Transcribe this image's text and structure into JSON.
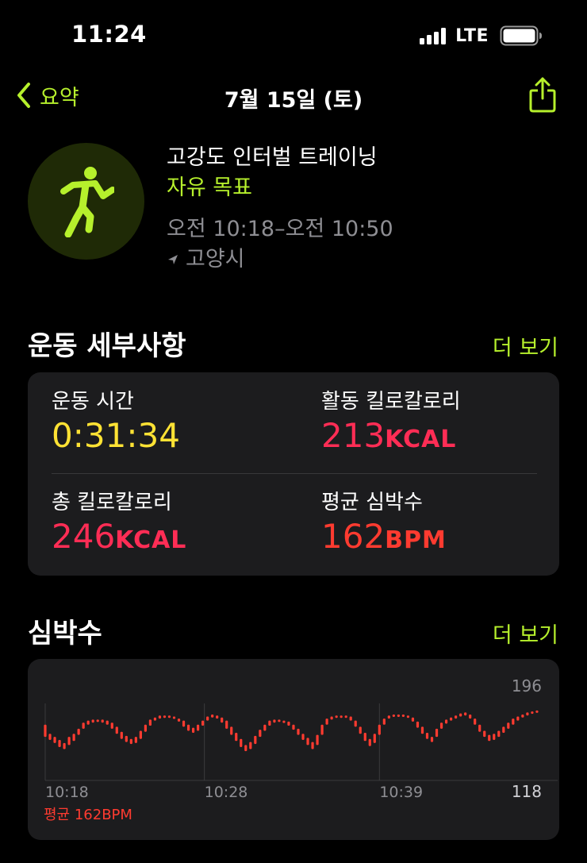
{
  "status_bar": {
    "time": "11:24",
    "network": "LTE"
  },
  "nav": {
    "back_label": "요약",
    "title": "7월 15일 (토)"
  },
  "workout": {
    "name": "고강도 인터벌 트레이닝",
    "goal": "자유 목표",
    "time_range": "오전 10:18–오전 10:50",
    "location": "고양시"
  },
  "details": {
    "title": "운동 세부사항",
    "more_label": "더 보기",
    "metrics": [
      {
        "label": "운동 시간",
        "value": "0:31:34",
        "unit": "",
        "color": "#ffe234"
      },
      {
        "label": "활동 킬로칼로리",
        "value": "213",
        "unit": "KCAL",
        "color": "#ff2d55"
      },
      {
        "label": "총 킬로칼로리",
        "value": "246",
        "unit": "KCAL",
        "color": "#ff2d55"
      },
      {
        "label": "평균 심박수",
        "value": "162",
        "unit": "BPM",
        "color": "#ff3b30"
      }
    ]
  },
  "heart_rate": {
    "title": "심박수",
    "more_label": "더 보기",
    "avg_label": "평균 162BPM"
  },
  "chart_data": {
    "type": "bar",
    "ylim": [
      118,
      196
    ],
    "y_ticks": [
      "196",
      "118"
    ],
    "x_ticks": [
      "10:18",
      "10:28",
      "10:39"
    ],
    "x_range_minutes": [
      0,
      32
    ],
    "bar_color": "#ff3b30",
    "series": [
      {
        "values": [
          [
            0.0,
            160,
            172
          ],
          [
            0.3,
            157,
            163
          ],
          [
            0.6,
            154,
            160
          ],
          [
            0.9,
            150,
            157
          ],
          [
            1.2,
            148,
            154
          ],
          [
            1.5,
            152,
            160
          ],
          [
            1.8,
            156,
            163
          ],
          [
            2.1,
            162,
            168
          ],
          [
            2.4,
            168,
            174
          ],
          [
            2.7,
            172,
            176
          ],
          [
            3.0,
            174,
            177
          ],
          [
            3.3,
            175,
            177
          ],
          [
            3.6,
            174,
            177
          ],
          [
            3.9,
            172,
            176
          ],
          [
            4.2,
            168,
            174
          ],
          [
            4.5,
            163,
            170
          ],
          [
            4.8,
            158,
            165
          ],
          [
            5.1,
            155,
            161
          ],
          [
            5.4,
            153,
            158
          ],
          [
            5.7,
            154,
            160
          ],
          [
            6.0,
            158,
            166
          ],
          [
            6.3,
            165,
            172
          ],
          [
            6.6,
            171,
            177
          ],
          [
            6.9,
            176,
            179
          ],
          [
            7.2,
            178,
            181
          ],
          [
            7.5,
            179,
            181
          ],
          [
            7.8,
            179,
            181
          ],
          [
            8.1,
            178,
            180
          ],
          [
            8.4,
            175,
            178
          ],
          [
            8.7,
            170,
            176
          ],
          [
            9.0,
            166,
            172
          ],
          [
            9.3,
            164,
            169
          ],
          [
            9.6,
            166,
            172
          ],
          [
            9.9,
            171,
            176
          ],
          [
            10.2,
            176,
            180
          ],
          [
            10.5,
            179,
            182
          ],
          [
            10.8,
            178,
            181
          ],
          [
            11.1,
            174,
            179
          ],
          [
            11.4,
            168,
            176
          ],
          [
            11.7,
            162,
            170
          ],
          [
            12.0,
            156,
            164
          ],
          [
            12.3,
            150,
            158
          ],
          [
            12.6,
            146,
            152
          ],
          [
            12.9,
            148,
            155
          ],
          [
            13.2,
            153,
            161
          ],
          [
            13.5,
            160,
            167
          ],
          [
            13.8,
            166,
            172
          ],
          [
            14.1,
            171,
            176
          ],
          [
            14.4,
            174,
            177
          ],
          [
            14.7,
            175,
            177
          ],
          [
            15.0,
            174,
            176
          ],
          [
            15.3,
            171,
            175
          ],
          [
            15.6,
            167,
            172
          ],
          [
            15.9,
            162,
            168
          ],
          [
            16.2,
            157,
            163
          ],
          [
            16.5,
            152,
            159
          ],
          [
            16.8,
            148,
            155
          ],
          [
            17.1,
            152,
            162
          ],
          [
            17.4,
            162,
            172
          ],
          [
            17.7,
            172,
            178
          ],
          [
            18.0,
            177,
            180
          ],
          [
            18.3,
            179,
            181
          ],
          [
            18.6,
            180,
            181
          ],
          [
            18.9,
            179,
            181
          ],
          [
            19.2,
            176,
            180
          ],
          [
            19.5,
            170,
            176
          ],
          [
            19.8,
            163,
            170
          ],
          [
            20.1,
            156,
            164
          ],
          [
            20.4,
            151,
            158
          ],
          [
            20.7,
            154,
            163
          ],
          [
            21.0,
            162,
            172
          ],
          [
            21.3,
            172,
            178
          ],
          [
            21.6,
            178,
            181
          ],
          [
            21.9,
            180,
            182
          ],
          [
            22.2,
            181,
            182
          ],
          [
            22.5,
            180,
            182
          ],
          [
            22.8,
            179,
            181
          ],
          [
            23.1,
            175,
            179
          ],
          [
            23.4,
            169,
            175
          ],
          [
            23.7,
            163,
            170
          ],
          [
            24.0,
            158,
            164
          ],
          [
            24.3,
            155,
            160
          ],
          [
            24.6,
            160,
            168
          ],
          [
            24.9,
            168,
            174
          ],
          [
            25.2,
            173,
            177
          ],
          [
            25.5,
            176,
            179
          ],
          [
            25.8,
            178,
            181
          ],
          [
            26.1,
            180,
            183
          ],
          [
            26.4,
            181,
            184
          ],
          [
            26.7,
            178,
            182
          ],
          [
            27.0,
            172,
            178
          ],
          [
            27.3,
            165,
            172
          ],
          [
            27.6,
            160,
            166
          ],
          [
            27.9,
            156,
            162
          ],
          [
            28.2,
            157,
            163
          ],
          [
            28.5,
            160,
            166
          ],
          [
            28.8,
            164,
            170
          ],
          [
            29.1,
            168,
            174
          ],
          [
            29.4,
            172,
            178
          ],
          [
            29.7,
            176,
            180
          ],
          [
            30.0,
            179,
            182
          ],
          [
            30.3,
            181,
            184
          ],
          [
            30.6,
            183,
            185
          ],
          [
            30.9,
            184,
            186
          ]
        ]
      }
    ]
  }
}
